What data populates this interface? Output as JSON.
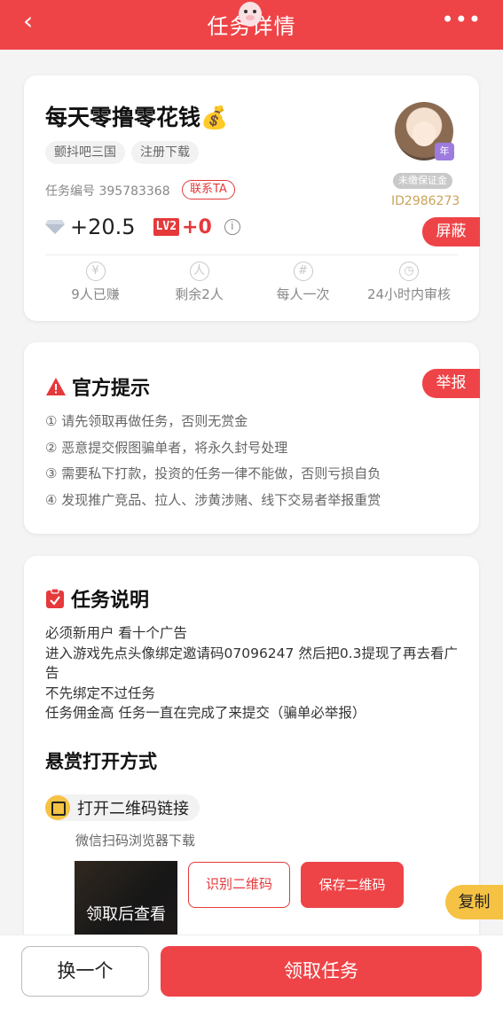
{
  "header": {
    "back_icon": "‹",
    "title": "任务详情",
    "more_icon": "•••"
  },
  "task": {
    "title": "每天零撸零花钱💰",
    "tags": [
      "颤抖吧三国",
      "注册下载"
    ],
    "number_label": "任务编号 395783368",
    "contact_label": "联系TA",
    "avatar_badge": "年",
    "deposit_label": "未缴保证金",
    "user_id": "ID2986273",
    "reward_amount": "+20.5",
    "level_badge": "LV2",
    "level_plus": "+0",
    "block_label": "屏蔽",
    "stats": [
      {
        "icon": "¥",
        "label": "9人已赚"
      },
      {
        "icon": "人",
        "label": "剩余2人"
      },
      {
        "icon": "#",
        "label": "每人一次"
      },
      {
        "icon": "◷",
        "label": "24小时内审核"
      }
    ]
  },
  "notice": {
    "title": "官方提示",
    "report_label": "举报",
    "items": [
      "① 请先领取再做任务，否则无赏金",
      "② 恶意提交假图骗单者，将永久封号处理",
      "③ 需要私下打款，投资的任务一律不能做，否则亏损自负",
      "④ 发现推广竞品、拉人、涉黄涉赌、线下交易者举报重赏"
    ]
  },
  "description": {
    "title": "任务说明",
    "lines": [
      "必须新用户 看十个广告",
      "进入游戏先点头像绑定邀请码07096247 然后把0.3提现了再去看广告",
      "不先绑定不过任务",
      "任务佣金高 任务一直在完成了来提交（骗单必举报）"
    ],
    "reward_method_title": "悬赏打开方式",
    "qr_label": "打开二维码链接",
    "scan_tip": "微信扫码浏览器下载",
    "thumb_label": "领取后查看",
    "identify_label": "识别二维码",
    "save_label": "保存二维码",
    "copy_label": "复制"
  },
  "footer": {
    "switch_label": "换一个",
    "claim_label": "领取任务"
  },
  "colors": {
    "accent": "#ee4447",
    "gold": "#c9a45a",
    "yellow": "#f6c244"
  }
}
